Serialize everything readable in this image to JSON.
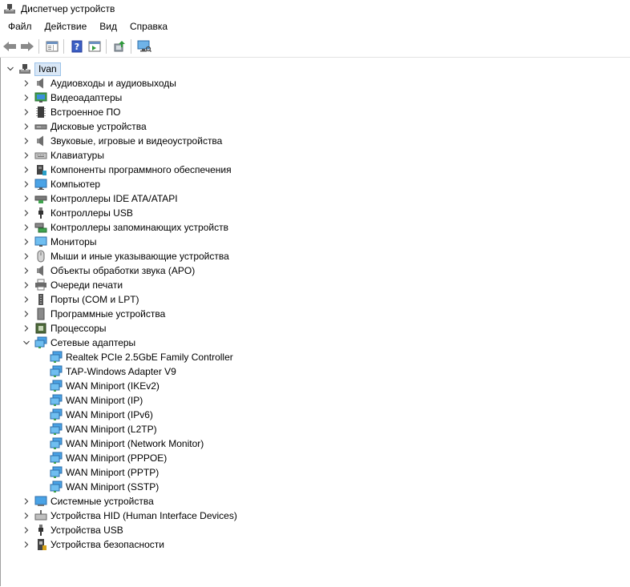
{
  "window": {
    "title": "Диспетчер устройств"
  },
  "menu": {
    "items": [
      "Файл",
      "Действие",
      "Вид",
      "Справка"
    ]
  },
  "tree": {
    "root": "Ivan",
    "categories": [
      {
        "label": "Аудиовходы и аудиовыходы",
        "icon": "speaker-icon"
      },
      {
        "label": "Видеоадаптеры",
        "icon": "display-adapter-icon"
      },
      {
        "label": "Встроенное ПО",
        "icon": "firmware-chip-icon"
      },
      {
        "label": "Дисковые устройства",
        "icon": "disk-drive-icon"
      },
      {
        "label": "Звуковые, игровые и видеоустройства",
        "icon": "speaker-icon"
      },
      {
        "label": "Клавиатуры",
        "icon": "keyboard-icon"
      },
      {
        "label": "Компоненты программного обеспечения",
        "icon": "software-component-icon"
      },
      {
        "label": "Компьютер",
        "icon": "computer-icon"
      },
      {
        "label": "Контроллеры IDE ATA/ATAPI",
        "icon": "ide-controller-icon"
      },
      {
        "label": "Контроллеры USB",
        "icon": "usb-icon"
      },
      {
        "label": "Контроллеры запоминающих устройств",
        "icon": "storage-controller-icon"
      },
      {
        "label": "Мониторы",
        "icon": "monitor-icon"
      },
      {
        "label": "Мыши и иные указывающие устройства",
        "icon": "mouse-icon"
      },
      {
        "label": "Объекты обработки звука (APO)",
        "icon": "speaker-icon"
      },
      {
        "label": "Очереди печати",
        "icon": "printer-icon"
      },
      {
        "label": "Порты (COM и LPT)",
        "icon": "port-icon"
      },
      {
        "label": "Программные устройства",
        "icon": "software-device-icon"
      },
      {
        "label": "Процессоры",
        "icon": "processor-icon"
      },
      {
        "label": "Сетевые адаптеры",
        "icon": "network-adapter-icon",
        "expanded": true,
        "children": [
          "Realtek PCIe 2.5GbE Family Controller",
          "TAP-Windows Adapter V9",
          "WAN Miniport (IKEv2)",
          "WAN Miniport (IP)",
          "WAN Miniport (IPv6)",
          "WAN Miniport (L2TP)",
          "WAN Miniport (Network Monitor)",
          "WAN Miniport (PPPOE)",
          "WAN Miniport (PPTP)",
          "WAN Miniport (SSTP)"
        ]
      },
      {
        "label": "Системные устройства",
        "icon": "system-device-icon"
      },
      {
        "label": "Устройства HID (Human Interface Devices)",
        "icon": "hid-icon"
      },
      {
        "label": "Устройства USB",
        "icon": "usb-icon"
      },
      {
        "label": "Устройства безопасности",
        "icon": "security-device-icon"
      }
    ]
  },
  "colors": {
    "selection_bg": "#d9e7f6",
    "selection_border": "#9cc3e8",
    "accent_blue": "#1e7bd6"
  }
}
